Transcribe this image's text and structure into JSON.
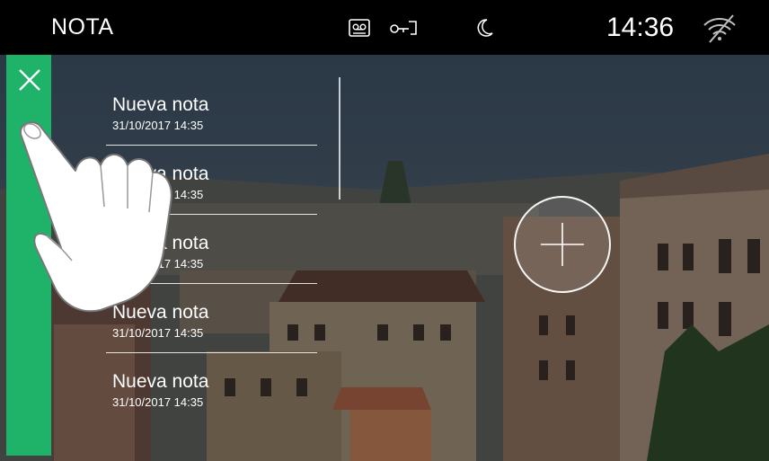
{
  "header": {
    "title": "NOTA",
    "time": "14:36",
    "icons": [
      "voicemail-icon",
      "key-icon",
      "moon-icon",
      "wifi-off-icon"
    ]
  },
  "notes": [
    {
      "title": "Nueva nota",
      "date": "31/10/2017 14:35"
    },
    {
      "title": "Nueva nota",
      "date": "31/10/2017 14:35"
    },
    {
      "title": "Nueva nota",
      "date": "31/10/2017 14:35"
    },
    {
      "title": "Nueva nota",
      "date": "31/10/2017 14:35"
    },
    {
      "title": "Nueva nota",
      "date": "31/10/2017 14:35"
    }
  ],
  "colors": {
    "accent_green": "#1fb36a",
    "statusbar": "#000000",
    "text": "#ffffff"
  }
}
